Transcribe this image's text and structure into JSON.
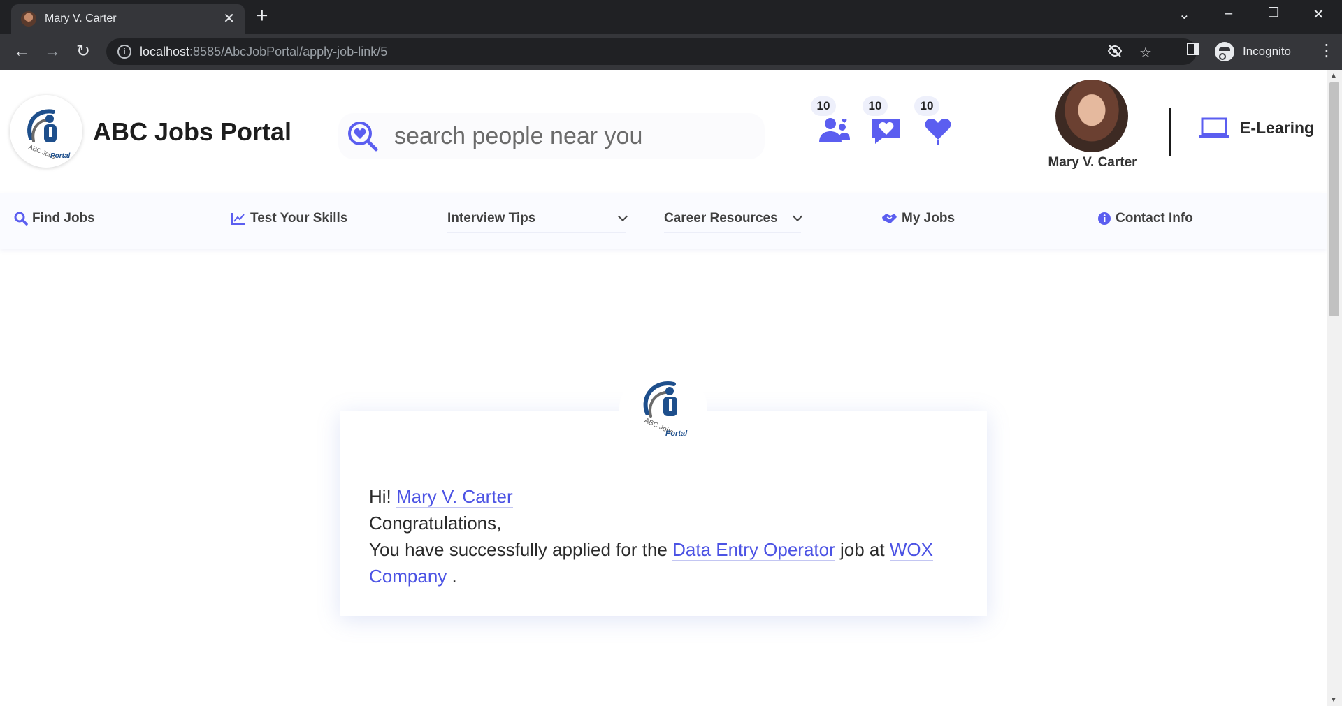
{
  "browser": {
    "tab_title": "Mary V. Carter",
    "url_host": "localhost",
    "url_path": ":8585/AbcJobPortal/apply-job-link/5",
    "profile_label": "Incognito"
  },
  "header": {
    "brand": "ABC Jobs Portal",
    "search_placeholder": "search people near you",
    "notifications": [
      {
        "count": "10",
        "icon": "people-icon"
      },
      {
        "count": "10",
        "icon": "chat-heart-icon"
      },
      {
        "count": "10",
        "icon": "heart-icon"
      }
    ],
    "user_name": "Mary V. Carter",
    "elearning_label": "E-Learing"
  },
  "nav": {
    "find_jobs": "Find Jobs",
    "test_skills": "Test Your Skills",
    "interview_tips": "Interview Tips",
    "career_resources": "Career Resources",
    "my_jobs": "My Jobs",
    "contact_info": "Contact Info"
  },
  "card": {
    "greeting": "Hi!",
    "user_name": "Mary V. Carter",
    "congrats": "Congratulations,",
    "applied_prefix": "You have successfully applied for the",
    "job_title": "Data Entry Operator",
    "job_at": "job at",
    "company": "WOX Company",
    "period": "."
  },
  "colors": {
    "accent": "#4c53e4",
    "icon_purple": "#5b5ef0",
    "browser_dark": "#202124"
  }
}
